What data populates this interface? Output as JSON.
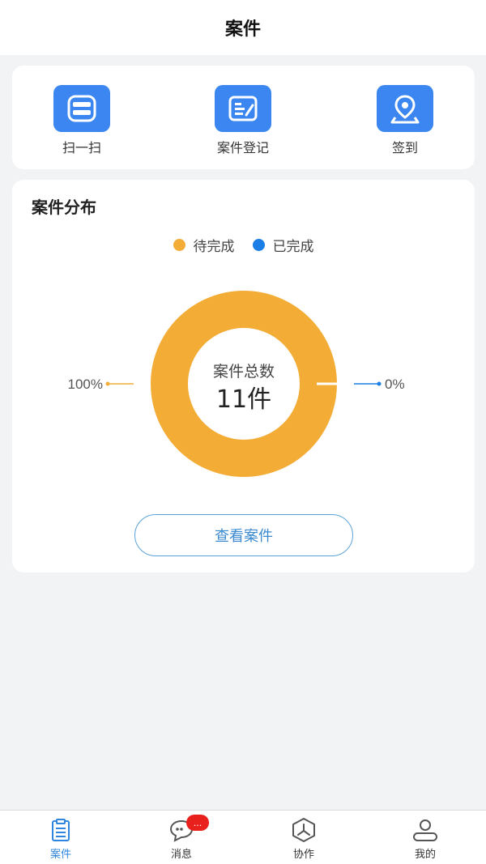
{
  "header": {
    "title": "案件"
  },
  "quick_actions": [
    {
      "label": "扫一扫",
      "icon": "scan-icon"
    },
    {
      "label": "案件登记",
      "icon": "register-form-icon"
    },
    {
      "label": "签到",
      "icon": "location-pin-icon"
    }
  ],
  "distribution": {
    "title": "案件分布",
    "button_label": "查看案件"
  },
  "chart_data": {
    "type": "pie",
    "donut": true,
    "legend_position": "top",
    "series": [
      {
        "name": "待完成",
        "value": 100,
        "label": "100%",
        "color": "#f3ad37"
      },
      {
        "name": "已完成",
        "value": 0,
        "label": "0%",
        "color": "#1a7ee6"
      }
    ],
    "center_label": "案件总数",
    "center_value": "11件"
  },
  "colors": {
    "accent": "#3b86f0",
    "pending": "#f3ad37",
    "done": "#1a7ee6",
    "badge": "#e8211d"
  },
  "tabbar": {
    "tabs": [
      {
        "label": "案件",
        "icon": "clipboard-icon",
        "active": true
      },
      {
        "label": "消息",
        "icon": "chat-bubble-icon",
        "badge": "..."
      },
      {
        "label": "协作",
        "icon": "collaboration-hexagon-icon"
      },
      {
        "label": "我的",
        "icon": "user-icon"
      }
    ]
  }
}
